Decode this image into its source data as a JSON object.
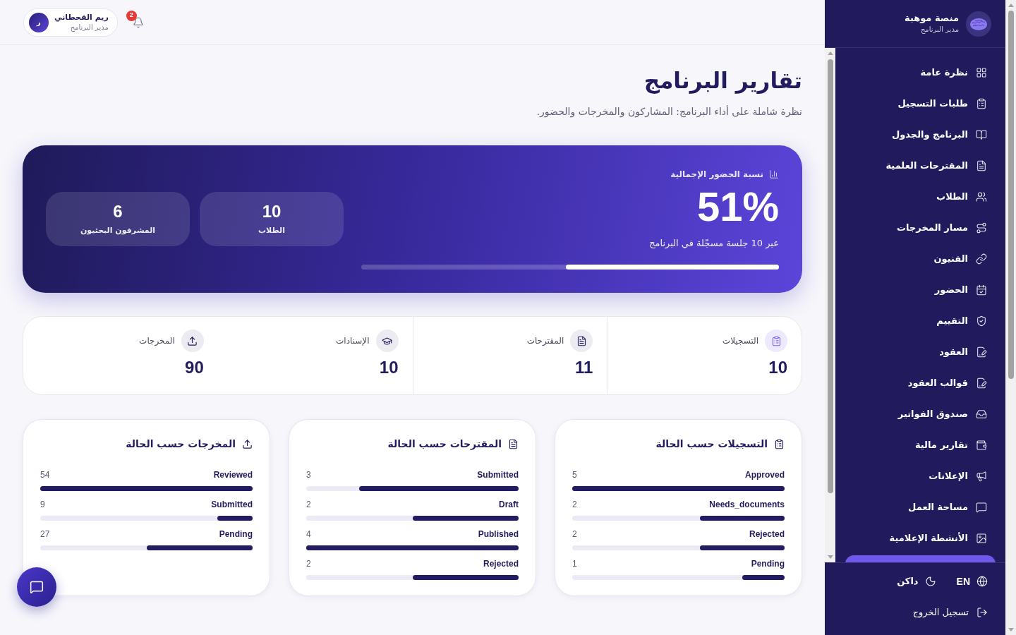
{
  "topbar": {
    "user": {
      "initial": "ر",
      "name": "ريم القحطاني",
      "role": "مدير البرنامج"
    },
    "notifications": {
      "count": "2"
    }
  },
  "header": {
    "title": "تقارير البرنامج",
    "subtitle": "نظرة شاملة على أداء البرنامج: المشاركون والمخرجات والحضور."
  },
  "attendance": {
    "label": "نسبة الحضور الإجمالية",
    "value": "51%",
    "caption": "عبر 10 جلسة مسجّلة في البرنامج",
    "level": 0.51,
    "stats": [
      {
        "value": "10",
        "label": "الطلاب"
      },
      {
        "value": "6",
        "label": "المشرفون البحثيون"
      }
    ]
  },
  "summary": [
    {
      "label": "التسجيلات",
      "value": "10",
      "highlighted": true
    },
    {
      "label": "المقترحات",
      "value": "11",
      "highlighted": false
    },
    {
      "label": "الإسنادات",
      "value": "10",
      "highlighted": false
    },
    {
      "label": "المخرجات",
      "value": "90",
      "highlighted": false
    }
  ],
  "status_cards": [
    {
      "title": "التسجيلات حسب الحالة",
      "rows": [
        {
          "label": "Approved",
          "count": "5",
          "level": 1
        },
        {
          "label": "Needs_documents",
          "count": "2",
          "level": 0.4
        },
        {
          "label": "Rejected",
          "count": "2",
          "level": 0.4
        },
        {
          "label": "Pending",
          "count": "1",
          "level": 0.2
        }
      ]
    },
    {
      "title": "المقترحات حسب الحالة",
      "rows": [
        {
          "label": "Submitted",
          "count": "3",
          "level": 0.75
        },
        {
          "label": "Draft",
          "count": "2",
          "level": 0.5
        },
        {
          "label": "Published",
          "count": "4",
          "level": 1
        },
        {
          "label": "Rejected",
          "count": "2",
          "level": 0.5
        }
      ]
    },
    {
      "title": "المخرجات حسب الحالة",
      "rows": [
        {
          "label": "Reviewed",
          "count": "54",
          "level": 1
        },
        {
          "label": "Submitted",
          "count": "9",
          "level": 0.167
        },
        {
          "label": "Pending",
          "count": "27",
          "level": 0.5
        }
      ]
    }
  ],
  "sidebar": {
    "brand": {
      "name": "منصة موهبة",
      "role": "مدير البرنامج"
    },
    "nav": [
      {
        "label": "نظرة عامة",
        "selected": false
      },
      {
        "label": "طلبات التسجيل",
        "selected": false
      },
      {
        "label": "البرنامج والجدول",
        "selected": false
      },
      {
        "label": "المقترحات العلمية",
        "selected": false
      },
      {
        "label": "الطلاب",
        "selected": false
      },
      {
        "label": "مسار المخرجات",
        "selected": false
      },
      {
        "label": "الفنيون",
        "selected": false
      },
      {
        "label": "الحضور",
        "selected": false
      },
      {
        "label": "التقييم",
        "selected": false
      },
      {
        "label": "العقود",
        "selected": false
      },
      {
        "label": "قوالب العقود",
        "selected": false
      },
      {
        "label": "صندوق الفواتير",
        "selected": false
      },
      {
        "label": "تقارير مالية",
        "selected": false
      },
      {
        "label": "الإعلانات",
        "selected": false
      },
      {
        "label": "مساحة العمل",
        "selected": false
      },
      {
        "label": "الأنشطة الإعلامية",
        "selected": false
      },
      {
        "selected": true
      }
    ],
    "language": "EN",
    "theme": "داكن",
    "logout": "تسجيل الخروج"
  }
}
